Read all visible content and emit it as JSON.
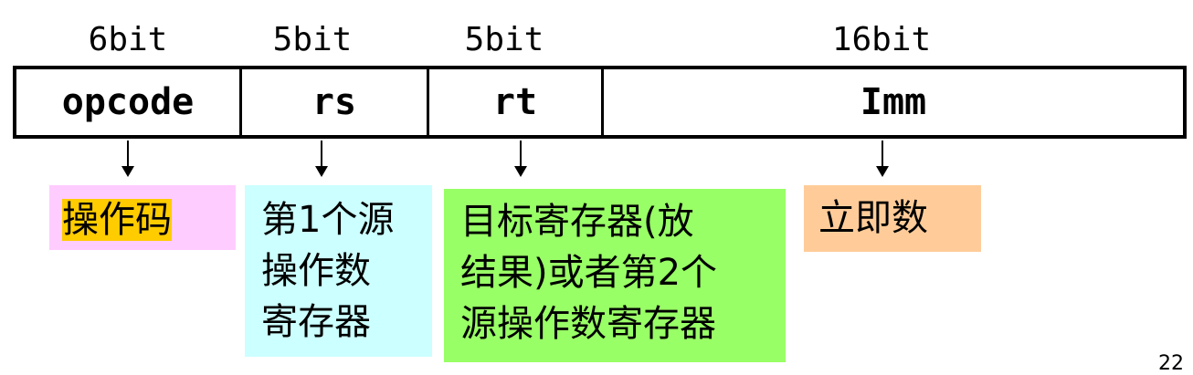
{
  "widths": [
    "6bit",
    "5bit",
    "5bit",
    "16bit"
  ],
  "fields": [
    "opcode",
    "rs",
    "rt",
    "Imm"
  ],
  "descriptions": {
    "opcode": {
      "lines": [
        "操作码"
      ],
      "bg": "#ffccff",
      "highlight": "#ffcc00"
    },
    "rs": {
      "lines": [
        "第1个源",
        "操作数",
        "寄存器"
      ],
      "bg": "#ccffff"
    },
    "rt": {
      "lines": [
        "目标寄存器(放",
        "结果)或者第2个",
        "源操作数寄存器"
      ],
      "bg": "#99ff66"
    },
    "imm": {
      "lines": [
        "立即数"
      ],
      "bg": "#ffcc99"
    }
  },
  "page_number": "22"
}
